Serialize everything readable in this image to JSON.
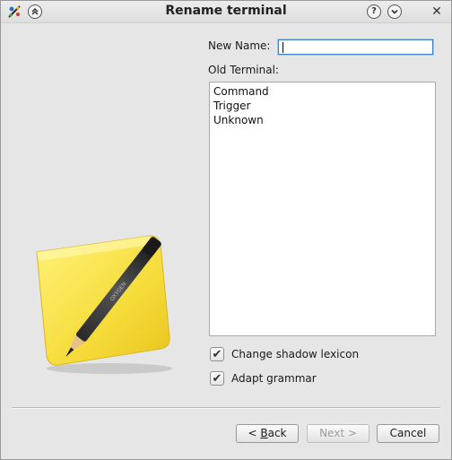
{
  "window": {
    "title": "Rename terminal",
    "help_glyph": "?",
    "collapse_glyph": "⌄",
    "shade_glyph": "︽",
    "close_glyph": "✕"
  },
  "form": {
    "new_name_label": "New Name:",
    "new_name_value": "",
    "old_terminal_label": "Old Terminal:"
  },
  "terminals": [
    "Command",
    "Trigger",
    "Unknown"
  ],
  "options": [
    {
      "label": "Change shadow lexicon",
      "checked": true
    },
    {
      "label": "Adapt grammar",
      "checked": true
    }
  ],
  "buttons": {
    "back_prefix": "< ",
    "back_mnemonic": "B",
    "back_rest": "ack",
    "next": "Next >",
    "cancel": "Cancel"
  },
  "icons": {
    "app": "kde-app-icon",
    "illustration": "sticky-note-pen-icon"
  }
}
